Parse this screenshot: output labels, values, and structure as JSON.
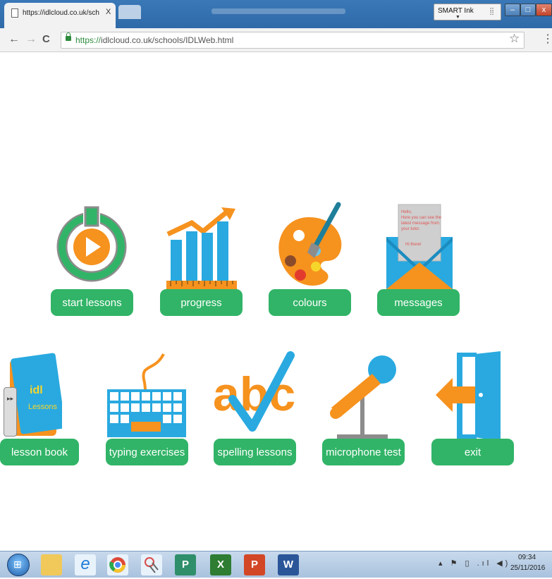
{
  "browser": {
    "tab": {
      "title": "https://idlcloud.co.uk/sch",
      "close": "X"
    },
    "smart_ink": {
      "label": "SMART Ink",
      "arrow": "▼",
      "grip": "⣿"
    },
    "window_controls": {
      "minimize": "–",
      "maximize": "□",
      "close": "x"
    },
    "nav": {
      "back": "←",
      "forward": "→",
      "reload": "C"
    },
    "address": {
      "scheme": "https://",
      "rest": "idlcloud.co.uk/schools/IDLWeb.html"
    },
    "bookmark_star": "☆",
    "menu": "⋮"
  },
  "tiles": [
    {
      "label": "start lessons",
      "icon": "power-play-icon"
    },
    {
      "label": "progress",
      "icon": "bar-chart-icon"
    },
    {
      "label": "colours",
      "icon": "palette-icon"
    },
    {
      "label": "messages",
      "icon": "envelope-icon"
    },
    {
      "label": "lesson book",
      "icon": "book-icon"
    },
    {
      "label": "typing exercises",
      "icon": "keyboard-icon"
    },
    {
      "label": "spelling lessons",
      "icon": "abc-check-icon"
    },
    {
      "label": "microphone test",
      "icon": "microphone-icon"
    },
    {
      "label": "exit",
      "icon": "exit-door-icon"
    }
  ],
  "message_note": [
    "Hello,",
    "Here you can see the",
    "latest message from",
    "your tutor.",
    "Hi there!"
  ],
  "book": {
    "brand": "idl",
    "title": "Lessons"
  },
  "spelling_letters": "abc",
  "side_handle": "▸▸",
  "taskbar": {
    "start": "⊞",
    "apps": [
      "explorer-icon",
      "internet-explorer-icon",
      "chrome-icon",
      "snipping-tool-icon",
      "publisher-icon",
      "excel-icon",
      "powerpoint-icon",
      "word-icon"
    ],
    "app_letters": [
      "",
      "e",
      "",
      "",
      "P",
      "X",
      "P",
      "W"
    ],
    "tray": "▴ ⚑ ▯ .ıl ◀)",
    "time": "09:34",
    "date": "25/11/2016"
  },
  "colors": {
    "tile_green": "#31b467",
    "blue": "#29a9e0",
    "orange": "#f6921e",
    "grey": "#8c8c8c"
  }
}
